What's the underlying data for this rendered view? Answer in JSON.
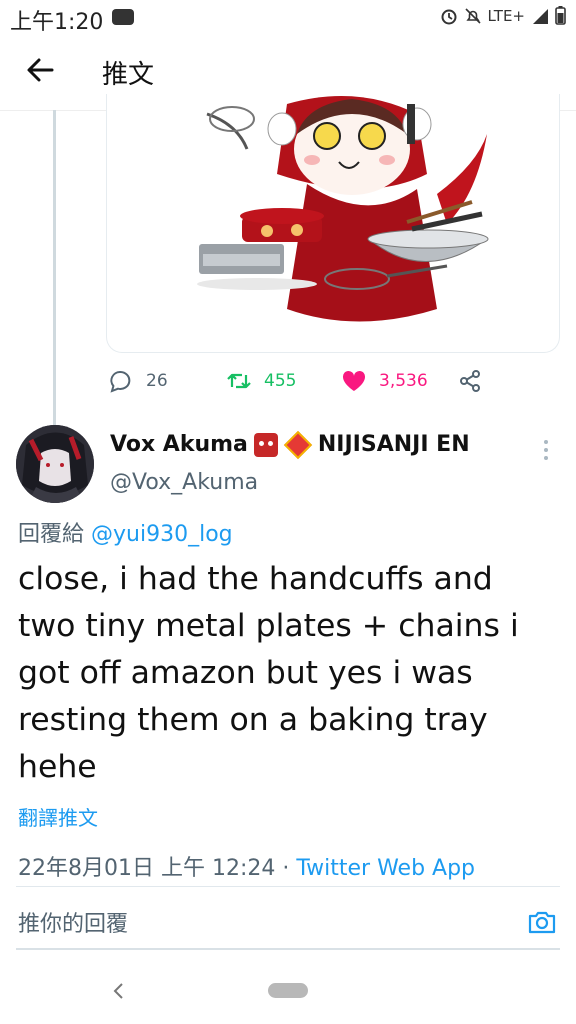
{
  "status": {
    "time": "上午1:20",
    "network": "LTE+"
  },
  "header": {
    "title": "推文"
  },
  "actions": {
    "replies": "26",
    "retweets": "455",
    "likes": "3,536"
  },
  "colors": {
    "accent": "#1d9bf0",
    "retweet": "#17bf63",
    "like": "#f91880",
    "muted": "#536471"
  },
  "tweet": {
    "author_name": "Vox Akuma",
    "author_tag": "NIJISANJI EN",
    "handle": "@Vox_Akuma",
    "reply_prefix": "回覆給",
    "reply_target": "@yui930_log",
    "text": "close, i had the handcuffs and two tiny metal plates + chains i got off amazon but yes i was resting them on a baking tray hehe",
    "translate": "翻譯推文",
    "timestamp": "22年8月01日 上午 12:24 · ",
    "app": "Twitter Web App"
  },
  "composer": {
    "placeholder": "推你的回覆"
  }
}
